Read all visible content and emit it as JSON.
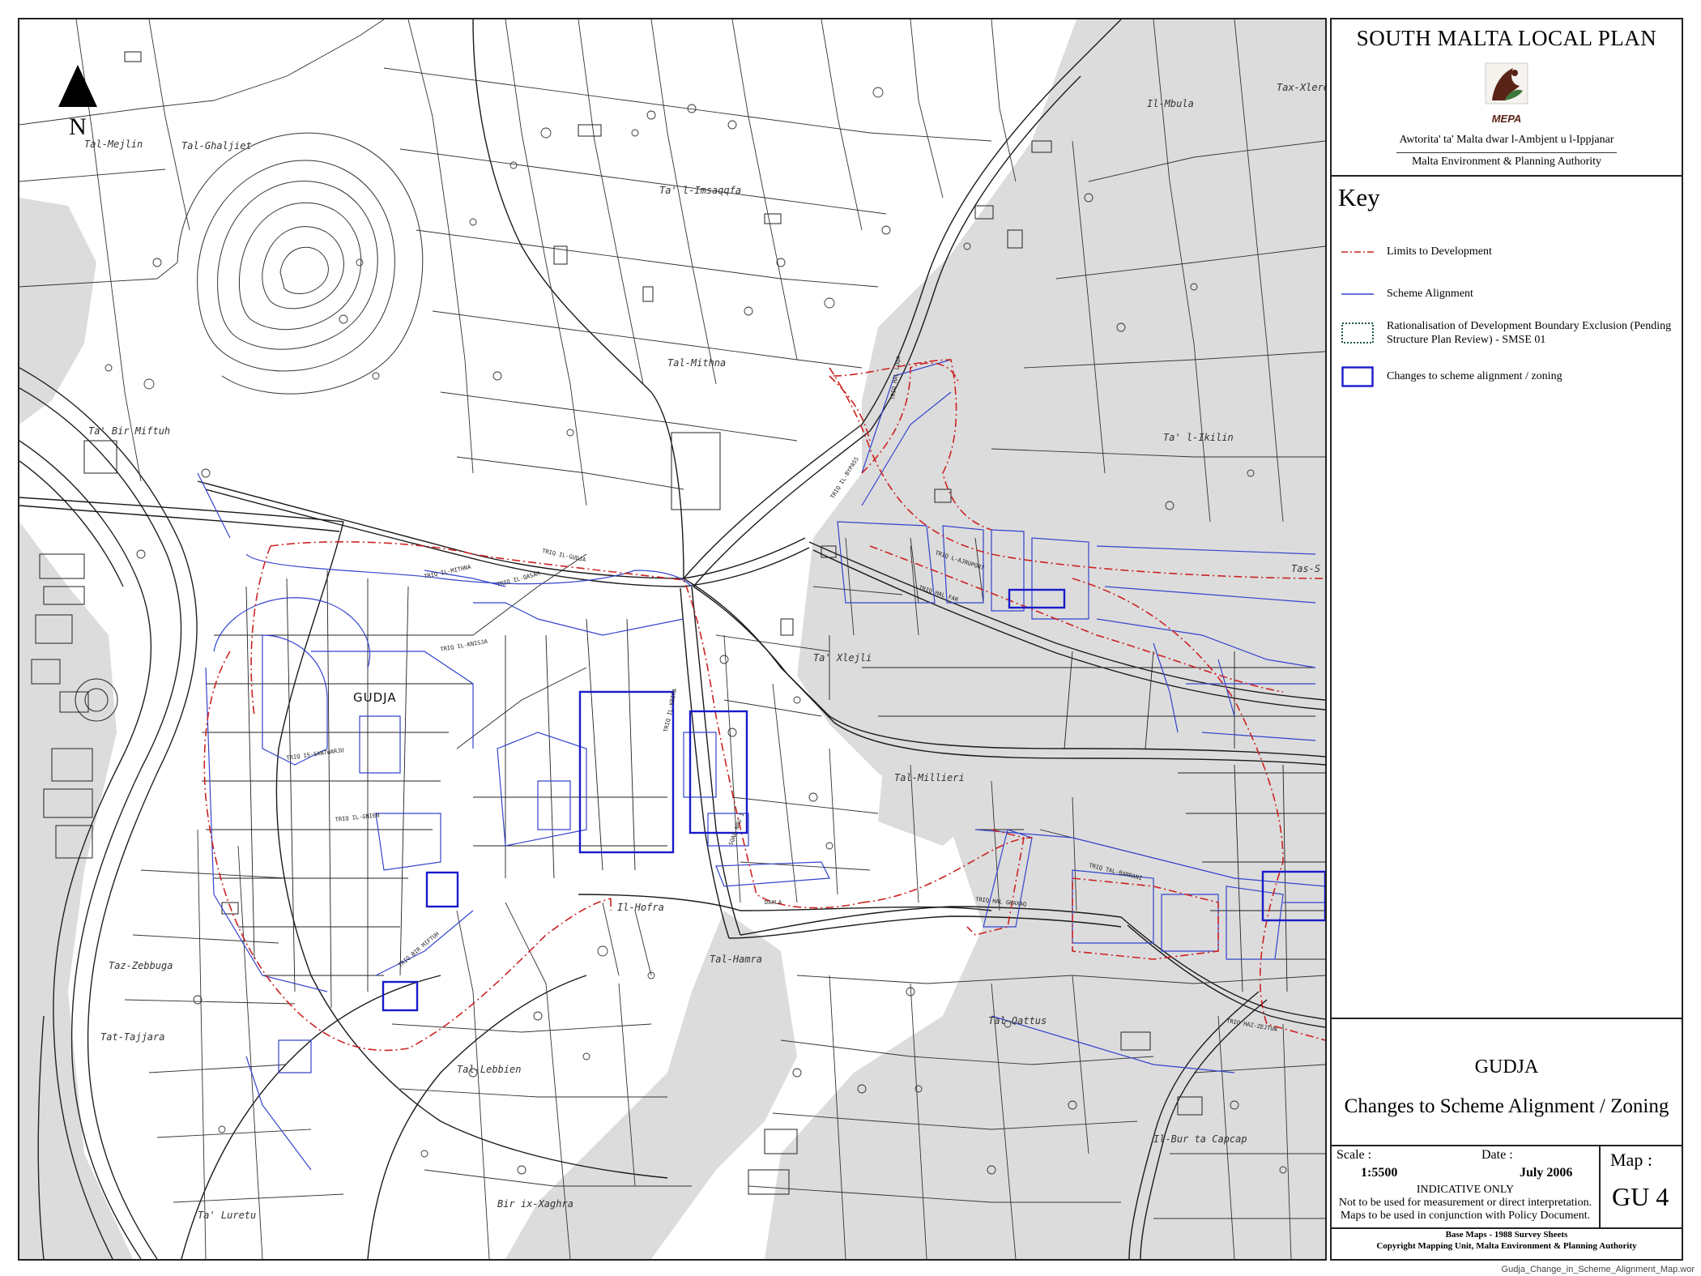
{
  "title_block": {
    "plan_title": "SOUTH MALTA LOCAL PLAN",
    "logo_text": "MEPA",
    "authority_mt": "Awtorita' ta' Malta dwar l-Ambjent u l-Ippjanar",
    "authority_en": "Malta Environment & Planning Authority"
  },
  "key": {
    "title": "Key",
    "items": [
      {
        "label": "Limits to Development",
        "symbol": "dash-dot-line",
        "color": "#cc2222"
      },
      {
        "label": "Scheme Alignment",
        "symbol": "solid-line",
        "color": "#3344cc"
      },
      {
        "label": "Rationalisation of Development Boundary Exclusion (Pending Structure Plan Review) - SMSE 01",
        "symbol": "dotted-box",
        "color": "#1e5a3a"
      },
      {
        "label": "Changes to scheme alignment / zoning",
        "symbol": "solid-box",
        "color": "#1a1acc"
      }
    ]
  },
  "map_title": {
    "place": "GUDJA",
    "heading": "Changes to Scheme Alignment / Zoning"
  },
  "info": {
    "scale_label": "Scale :",
    "scale_value": "1:5500",
    "date_label": "Date :",
    "date_value": "July 2006",
    "indicative_title": "INDICATIVE ONLY",
    "indicative_line1": "Not to be used for measurement or direct interpretation.",
    "indicative_line2": "Maps to be used in conjunction with Policy Document.",
    "map_label": "Map :",
    "map_number": "GU 4"
  },
  "credits": {
    "line1": "Base Maps - 1988 Survey Sheets",
    "line2": "Copyright Mapping Unit, Malta Environment & Planning Authority"
  },
  "map": {
    "north": "N",
    "town_label": "GUDJA",
    "places": {
      "mejlin": "Tal-Mejlin",
      "ghaljiet": "Tal-Ghaljiet",
      "imsaqqfa": "Ta' l-Imsaqqfa",
      "mithna": "Tal-Mithna",
      "birmiftuh": "Ta' Bir Miftuh",
      "ikilin": "Ta' l-Ikilin",
      "mbula": "Il-Mbula",
      "xlere": "Tax-Xlere",
      "xlejli": "Ta' Xlejli",
      "millieri": "Tal-Millieri",
      "hofra": "Il-Hofra",
      "hamra": "Tal-Hamra",
      "zebbuga": "Taz-Zebbuga",
      "tajjara": "Tat-Tajjara",
      "lebbien": "Tal-Lebbien",
      "qattus": "Tal-Qattus",
      "birlacapcap": "Il-Bur ta Capcap",
      "luretu": "Ta' Luretu",
      "birixxaghra": "Bir ix-Xaghra",
      "tass": "Tas-S"
    },
    "streets": {
      "hal_luqa": "TRIQ HAL LUQA",
      "bypass": "TRIQ IL-BYPASS",
      "gudja": "TRIQ IL-GUDJA",
      "hal_far": "TRIQ HAL FAR",
      "kbira": "TRIQ IL-KBIRA",
      "knisja": "TRIQ IL-KNISJA",
      "qasam": "TRIQ IL-QASAM",
      "sqaq": "SQAQ NRU 1",
      "airport": "TRIQ L-AJRUPORT",
      "santwarju": "TRIQ IS-SANTWARJU",
      "gnien": "TRIQ IL-GNIEN",
      "mithna": "TRIQ IL-MITHNA",
      "dahla": "DAHLA",
      "bir": "TRIQ BIR MIFTUH",
      "tal_barrani": "TRIQ TAL-BARRANI",
      "zejtun": "TRIQ HAZ-ZEJTUN",
      "bormla": "TRIQ HAL GHAXAQ"
    }
  },
  "footer": {
    "filename": "Gudja_Change_in_Scheme_Alignment_Map.wor"
  }
}
